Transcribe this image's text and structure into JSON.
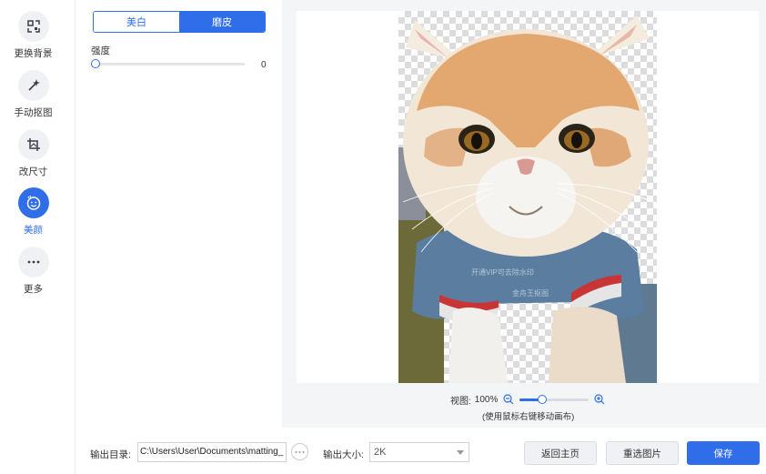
{
  "sidebar": {
    "items": [
      {
        "label": "更换背景",
        "icon": "replace-background-icon"
      },
      {
        "label": "手动抠图",
        "icon": "magic-wand-icon"
      },
      {
        "label": "改尺寸",
        "icon": "resize-crop-icon"
      },
      {
        "label": "美颜",
        "icon": "beauty-face-icon",
        "active": true
      },
      {
        "label": "更多",
        "icon": "more-dots-icon"
      }
    ]
  },
  "panel": {
    "tabs": [
      {
        "label": "美白",
        "active": false
      },
      {
        "label": "磨皮",
        "active": true
      }
    ],
    "strength_label": "强度",
    "strength_value": "0",
    "strength_fraction": 0
  },
  "preview": {
    "watermark": "开通VIP可去除水印",
    "watermark_brand": "金舟王抠图",
    "zoom_label": "视图:",
    "zoom_value": "100%",
    "zoom_fraction": 0.32,
    "hint": "(使用鼠标右键移动画布)"
  },
  "bottom": {
    "output_dir_label": "输出目录:",
    "output_dir_value": "C:\\Users\\User\\Documents\\matting_",
    "output_size_label": "输出大小:",
    "output_size_value": "2K",
    "home_button": "返回主页",
    "reselect_button": "重选图片",
    "save_button": "保存"
  },
  "colors": {
    "accent": "#2f6ee8"
  }
}
